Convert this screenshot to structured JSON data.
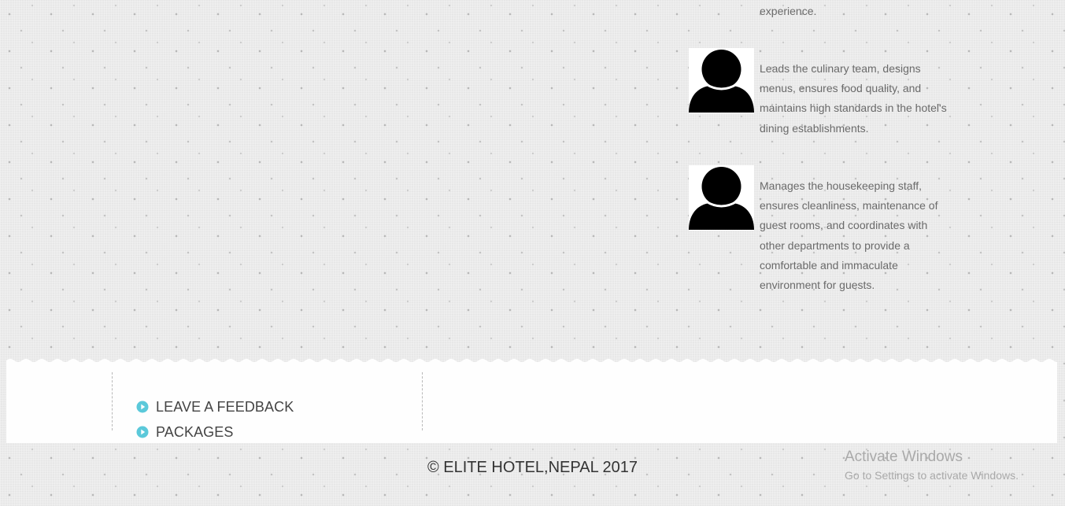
{
  "staff_section": {
    "top_fragment": "experience.",
    "members": [
      {
        "avatar_icon": "person-silhouette-icon",
        "description": "Leads the culinary team, designs menus, ensures food quality, and maintains high standards in the hotel's dining establishments."
      },
      {
        "avatar_icon": "person-silhouette-icon",
        "description": "Manages the housekeeping staff, ensures cleanliness, maintenance of guest rooms, and coordinates with other departments to provide a comfortable and immaculate environment for guests."
      }
    ]
  },
  "footer": {
    "links": [
      {
        "label": "LEAVE A FEEDBACK",
        "icon": "play-circle-icon"
      },
      {
        "label": "PACKAGES",
        "icon": "play-circle-icon"
      }
    ],
    "copyright": "© ELITE HOTEL,NEPAL 2017"
  },
  "watermark": {
    "title": "Activate Windows",
    "subtitle": "Go to Settings to activate Windows."
  },
  "colors": {
    "accent_icon": "#5bc9da",
    "page_background": "#ebebeb",
    "footer_panel": "#fefefe",
    "body_text": "#6a6a6a"
  }
}
